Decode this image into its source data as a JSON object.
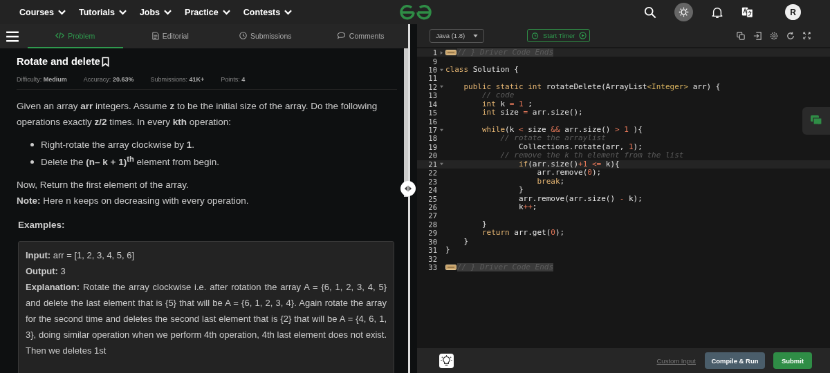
{
  "nav": {
    "menus": [
      {
        "label": "Courses"
      },
      {
        "label": "Tutorials"
      },
      {
        "label": "Jobs"
      },
      {
        "label": "Practice"
      },
      {
        "label": "Contests"
      }
    ],
    "avatar": "R"
  },
  "tabs": [
    {
      "label": "Problem",
      "selected": true
    },
    {
      "label": "Editorial",
      "selected": false
    },
    {
      "label": "Submissions",
      "selected": false
    },
    {
      "label": "Comments",
      "selected": false
    }
  ],
  "problem": {
    "title": "Rotate and delete",
    "meta": [
      {
        "label": "Difficulty:",
        "value": "Medium"
      },
      {
        "label": "Accuracy:",
        "value": "20.63%"
      },
      {
        "label": "Submissions:",
        "value": "41K+"
      },
      {
        "label": "Points:",
        "value": "4"
      }
    ],
    "intro": "Given an array **arr** integers. Assume **z** to be the initial size of the array. Do the following operations exactly **z/2** times. In every **kth** operation:",
    "bullets": [
      "Right-rotate the array clockwise by **1**.",
      "Delete the **(n– k + 1)**$^{th}$ element from begin."
    ],
    "after": [
      "Now, Return the first element of the array.",
      "**Note:** Here n keeps on decreasing with every operation."
    ],
    "examples_heading": "Examples:",
    "example": [
      "**Input:** arr = [1, 2, 3, 4, 5, 6]",
      "**Output:** 3",
      "**Explanation:** Rotate the array clockwise i.e. after rotation the array A = {6, 1, 2, 3, 4, 5} and delete the last element that is {5} that will be A = {6, 1, 2, 3, 4}. Again rotate the array for the second time and deletes the second last element that is {2} that will be A = {4, 6, 1, 3}, doing similar operation when we perform 4th operation, 4th last element does not exist. Then we deletes 1st"
    ]
  },
  "editor": {
    "language": "Java (1.8)",
    "timer": "Start Timer",
    "lines": [
      {
        "num": "1",
        "fold_open": false,
        "folded": true,
        "highlighted": true,
        "tokens": [
          {
            "t": "// } Driver Code Ends",
            "kind": "comment"
          }
        ]
      },
      {
        "num": "9"
      },
      {
        "num": "10",
        "fold_open": true,
        "tokens": [
          {
            "t": "class",
            "kind": "keyword"
          },
          {
            "t": " Solution {",
            "kind": "plain"
          }
        ]
      },
      {
        "num": "11"
      },
      {
        "num": "12",
        "fold_open": true,
        "tokens": [
          {
            "t": "    public static int",
            "kind": "keyword"
          },
          {
            "t": " rotateDelete(ArrayList",
            "kind": "plain"
          },
          {
            "t": "<Integer>",
            "kind": "type"
          },
          {
            "t": " arr) {",
            "kind": "plain"
          }
        ]
      },
      {
        "num": "13",
        "tokens": [
          {
            "t": "        // code",
            "kind": "comment"
          }
        ]
      },
      {
        "num": "14",
        "tokens": [
          {
            "t": "        int",
            "kind": "keyword"
          },
          {
            "t": " k ",
            "kind": "plain"
          },
          {
            "t": "=",
            "kind": "operator"
          },
          {
            "t": " 1",
            "kind": "number"
          },
          {
            "t": " ;",
            "kind": "plain"
          }
        ]
      },
      {
        "num": "15",
        "tokens": [
          {
            "t": "        int",
            "kind": "keyword"
          },
          {
            "t": " size ",
            "kind": "plain"
          },
          {
            "t": "=",
            "kind": "operator"
          },
          {
            "t": " arr.size();",
            "kind": "plain"
          }
        ]
      },
      {
        "num": "16"
      },
      {
        "num": "17",
        "fold_open": true,
        "tokens": [
          {
            "t": "        while",
            "kind": "keyword"
          },
          {
            "t": "(k ",
            "kind": "plain"
          },
          {
            "t": "<",
            "kind": "operator"
          },
          {
            "t": " size ",
            "kind": "plain"
          },
          {
            "t": "&&",
            "kind": "operator"
          },
          {
            "t": " arr.size() ",
            "kind": "plain"
          },
          {
            "t": ">",
            "kind": "operator"
          },
          {
            "t": " 1",
            "kind": "number"
          },
          {
            "t": " ){",
            "kind": "plain"
          }
        ]
      },
      {
        "num": "18",
        "tokens": [
          {
            "t": "            // rotate the arraylist",
            "kind": "comment"
          }
        ]
      },
      {
        "num": "19",
        "tokens": [
          {
            "t": "                Collections.rotate(arr, ",
            "kind": "plain"
          },
          {
            "t": "1",
            "kind": "number"
          },
          {
            "t": ");",
            "kind": "plain"
          }
        ]
      },
      {
        "num": "20",
        "tokens": [
          {
            "t": "            // remove the k th element from the list",
            "kind": "comment"
          }
        ]
      },
      {
        "num": "21",
        "fold_open": true,
        "highlighted": true,
        "tokens": [
          {
            "t": "                if",
            "kind": "keyword"
          },
          {
            "t": "(arr.size()",
            "kind": "plain"
          },
          {
            "t": "+1",
            "kind": "number"
          },
          {
            "t": " <=",
            "kind": "operator"
          },
          {
            "t": " k){",
            "kind": "plain"
          }
        ]
      },
      {
        "num": "22",
        "tokens": [
          {
            "t": "                    arr.remove(",
            "kind": "plain"
          },
          {
            "t": "0",
            "kind": "number"
          },
          {
            "t": ");",
            "kind": "plain"
          }
        ]
      },
      {
        "num": "23",
        "tokens": [
          {
            "t": "                    break",
            "kind": "keyword"
          },
          {
            "t": ";",
            "kind": "plain"
          }
        ]
      },
      {
        "num": "24",
        "tokens": [
          {
            "t": "                }",
            "kind": "plain"
          }
        ]
      },
      {
        "num": "25",
        "tokens": [
          {
            "t": "                arr.remove(arr.size() ",
            "kind": "plain"
          },
          {
            "t": "-",
            "kind": "operator"
          },
          {
            "t": " k);",
            "kind": "plain"
          }
        ]
      },
      {
        "num": "26",
        "tokens": [
          {
            "t": "                k",
            "kind": "plain"
          },
          {
            "t": "++",
            "kind": "operator"
          },
          {
            "t": ";",
            "kind": "plain"
          }
        ]
      },
      {
        "num": "27"
      },
      {
        "num": "28",
        "tokens": [
          {
            "t": "        }",
            "kind": "plain"
          }
        ]
      },
      {
        "num": "29",
        "tokens": [
          {
            "t": "        return",
            "kind": "keyword"
          },
          {
            "t": " arr.get(",
            "kind": "plain"
          },
          {
            "t": "0",
            "kind": "number"
          },
          {
            "t": ");",
            "kind": "plain"
          }
        ]
      },
      {
        "num": "30",
        "tokens": [
          {
            "t": "    }",
            "kind": "plain"
          }
        ]
      },
      {
        "num": "31",
        "tokens": [
          {
            "t": "}",
            "kind": "plain"
          }
        ]
      },
      {
        "num": "32"
      },
      {
        "num": "33",
        "folded": true,
        "tokens": [
          {
            "t": "// } Driver Code Ends",
            "kind": "comment"
          }
        ]
      }
    ],
    "custom_input": "Custom Input",
    "compile": "Compile & Run",
    "submit": "Submit"
  }
}
